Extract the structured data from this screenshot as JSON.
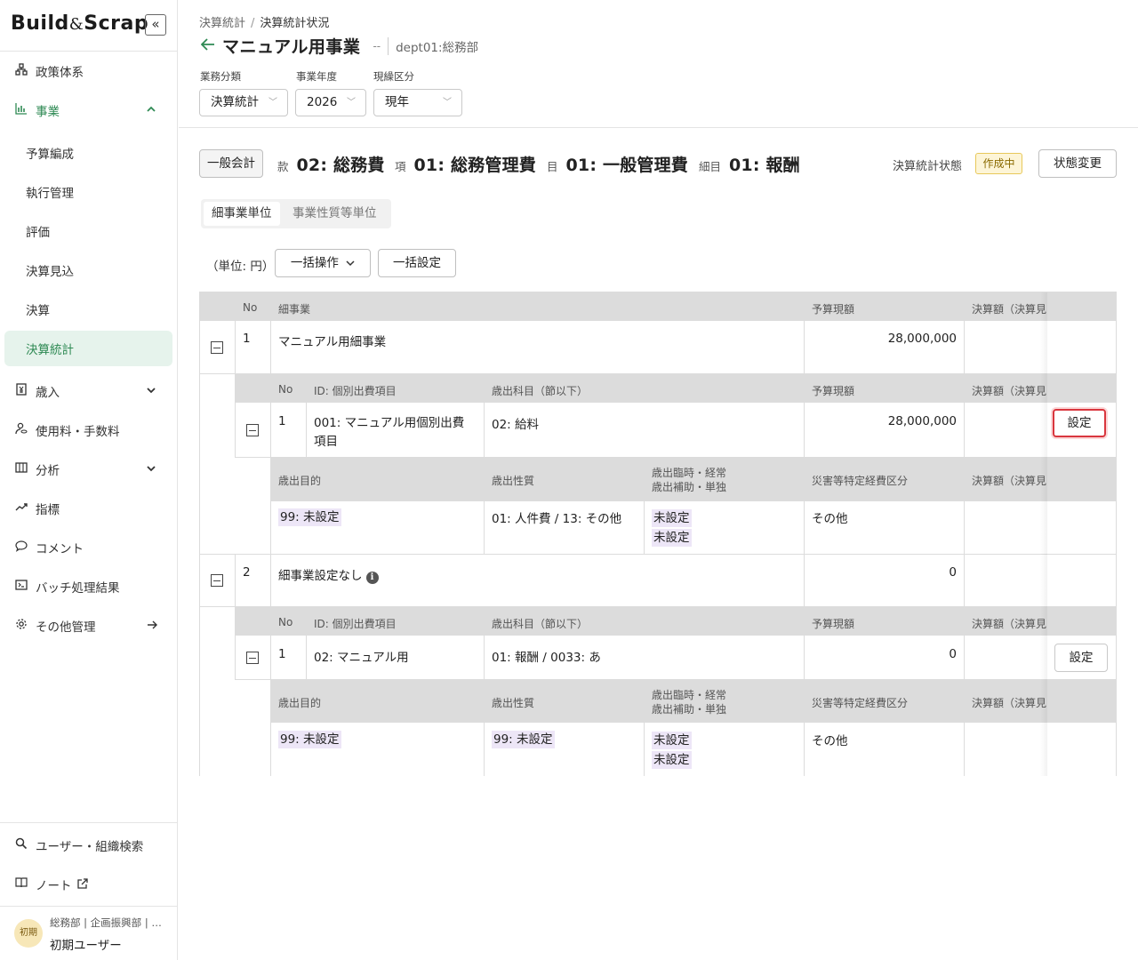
{
  "sidebar": {
    "logo": {
      "part1": "Build",
      "amp": "&",
      "part2": "Scrap"
    },
    "collapse_icon": "«",
    "nav": [
      {
        "label": "政策体系",
        "icon": "org-chart-icon"
      },
      {
        "label": "事業",
        "icon": "bar-chart-icon",
        "expanded": true
      },
      {
        "label": "歳入",
        "icon": "yen-doc-icon"
      },
      {
        "label": "使用料・手数料",
        "icon": "user-coins-icon"
      },
      {
        "label": "分析",
        "icon": "table-icon"
      },
      {
        "label": "指標",
        "icon": "trend-icon"
      },
      {
        "label": "コメント",
        "icon": "comment-icon"
      },
      {
        "label": "バッチ処理結果",
        "icon": "terminal-icon"
      },
      {
        "label": "その他管理",
        "icon": "gear-icon"
      }
    ],
    "sub_items": [
      "予算編成",
      "執行管理",
      "評価",
      "決算見込",
      "決算",
      "決算統計"
    ],
    "bottom": [
      {
        "label": "ユーザー・組織検索",
        "icon": "search-icon"
      },
      {
        "label": "ノート",
        "icon": "book-icon"
      }
    ],
    "user": {
      "avatar": "初期",
      "org": "総務部 | 企画振興部 | …",
      "name": "初期ユーザー"
    }
  },
  "header": {
    "breadcrumb": [
      "決算統計",
      "決算統計状況"
    ],
    "title": "マニュアル用事業",
    "dash": "--",
    "dept": "dept01:総務部",
    "filters": [
      {
        "label": "業務分類",
        "value": "決算統計"
      },
      {
        "label": "事業年度",
        "value": "2026"
      },
      {
        "label": "現繰区分",
        "value": "現年"
      }
    ]
  },
  "budget": {
    "account": "一般会計",
    "kan_label": "款",
    "kan_value": "02: 総務費",
    "kou_label": "項",
    "kou_value": "01: 総務管理費",
    "moku_label": "目",
    "moku_value": "01: 一般管理費",
    "saimoku_label": "細目",
    "saimoku_value": "01: 報酬",
    "status_label": "決算統計状態",
    "status_value": "作成中",
    "change_button": "状態変更"
  },
  "tabs": {
    "tab1": "細事業単位",
    "tab2": "事業性質等単位"
  },
  "toolbar": {
    "unit": "（単位: 円）",
    "bulk_ops": "一括操作",
    "bulk_set": "一括設定"
  },
  "table": {
    "header": {
      "no": "No",
      "project": "細事業",
      "budget": "予算現額",
      "settle": "決算額（決算見"
    },
    "sub_header": {
      "no": "No",
      "id": "ID: 個別出費項目",
      "item": "歳出科目（節以下）",
      "budget": "予算現額",
      "settle": "決算額（決算見"
    },
    "detail_header": {
      "purpose": "歳出目的",
      "nature": "歳出性質",
      "temp1": "歳出臨時・経常",
      "temp2": "歳出補助・単独",
      "disaster": "災害等特定経費区分",
      "settle": "決算額（決算見"
    },
    "set_label": "設定",
    "rows": [
      {
        "no": "1",
        "name": "マニュアル用細事業",
        "budget": "28,000,000",
        "sub": {
          "no": "1",
          "id_line1": "001: マニュアル用個別出費",
          "id_line2": "項目",
          "item": "02: 給料",
          "budget": "28,000,000",
          "purpose": "99: 未設定",
          "nature": "01: 人件費 / 13: その他",
          "temp1": "未設定",
          "temp2": "未設定",
          "disaster": "その他"
        }
      },
      {
        "no": "2",
        "name": "細事業設定なし",
        "budget": "0",
        "sub": {
          "no": "1",
          "id_line1": "02: マニュアル用",
          "item": "01: 報酬 / 0033: あ",
          "budget": "0",
          "purpose": "99: 未設定",
          "nature": "99: 未設定",
          "temp1": "未設定",
          "temp2": "未設定",
          "disaster": "その他"
        }
      }
    ]
  },
  "colors": {
    "accent": "#2f8a54",
    "header_bg": "#dcdcdc",
    "tag_bg": "#ede6f7",
    "highlight": "#d9363e",
    "status_bg": "#fdf5d7"
  }
}
